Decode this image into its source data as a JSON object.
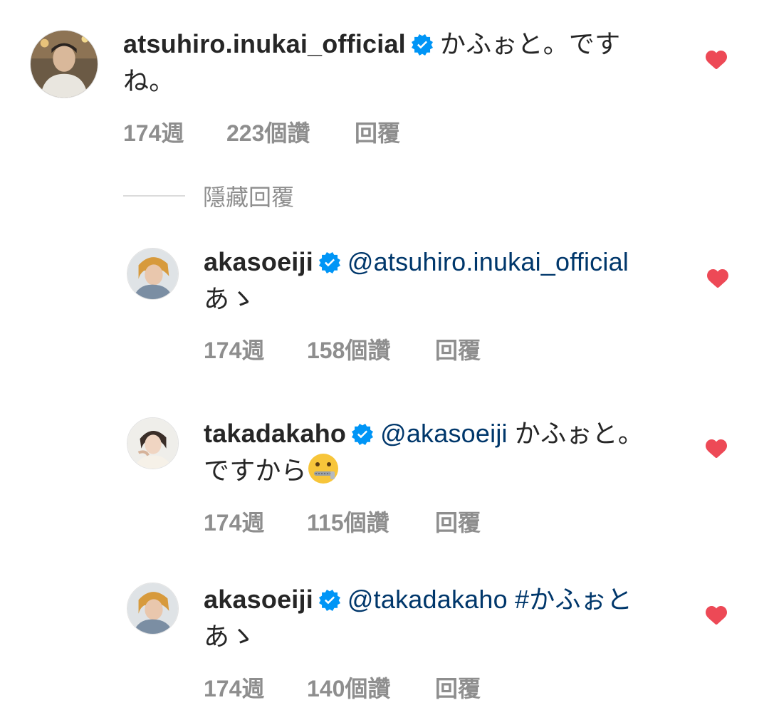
{
  "colors": {
    "text": "#262626",
    "meta": "#8e8e8e",
    "mention": "#00376b",
    "verified": "#0095f6",
    "heart": "#ed4956"
  },
  "hide_replies_label": "隱藏回覆",
  "comments": [
    {
      "username": "atsuhiro.inukai_official",
      "verified": true,
      "text_line1": "かふぉと。です",
      "text_line2": "ね。",
      "time": "174週",
      "likes": "223個讚",
      "reply_label": "回覆",
      "liked": true,
      "avatar_icon": "profile-photo"
    },
    {
      "username": "akasoeiji",
      "verified": true,
      "mention": "@atsuhiro.inukai_official",
      "text_line2": "あゝ",
      "time": "174週",
      "likes": "158個讚",
      "reply_label": "回覆",
      "liked": true,
      "avatar_icon": "profile-photo"
    },
    {
      "username": "takadakaho",
      "verified": true,
      "mention": "@akasoeiji",
      "text_line1": "かふぉと。",
      "text_line2": "ですから",
      "emoji": "zipper-mouth-face",
      "time": "174週",
      "likes": "115個讚",
      "reply_label": "回覆",
      "liked": true,
      "avatar_icon": "profile-photo"
    },
    {
      "username": "akasoeiji",
      "verified": true,
      "mention": "@takadakaho",
      "hashtag": "#かふぉと",
      "text_line2": "あゝ",
      "time": "174週",
      "likes": "140個讚",
      "reply_label": "回覆",
      "liked": true,
      "avatar_icon": "profile-photo"
    }
  ]
}
